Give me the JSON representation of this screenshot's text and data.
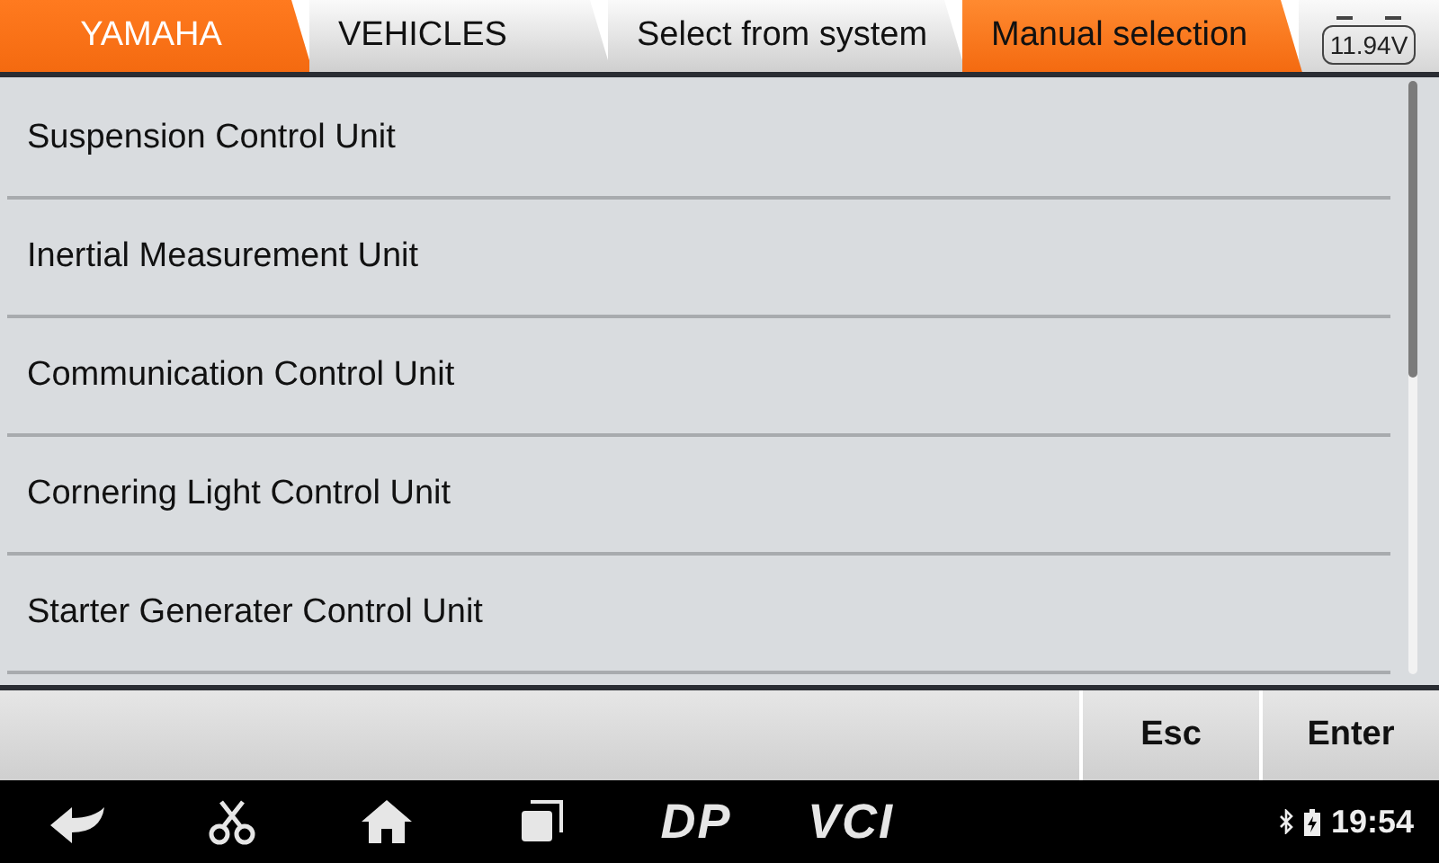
{
  "breadcrumbs": [
    {
      "label": "YAMAHA",
      "kind": "brand"
    },
    {
      "label": "VEHICLES",
      "kind": "crumb"
    },
    {
      "label": "Select from system",
      "kind": "crumb"
    },
    {
      "label": "Manual selection",
      "kind": "current"
    }
  ],
  "battery": {
    "voltage": "11.94V"
  },
  "items": [
    {
      "label": "Suspension Control Unit"
    },
    {
      "label": "Inertial Measurement Unit"
    },
    {
      "label": "Communication Control Unit"
    },
    {
      "label": "Cornering Light Control Unit"
    },
    {
      "label": "Starter Generater Control Unit"
    }
  ],
  "buttons": [
    "Esc",
    "Enter"
  ],
  "navbar": {
    "logos": [
      "DP",
      "VCI"
    ],
    "time": "19:54"
  }
}
